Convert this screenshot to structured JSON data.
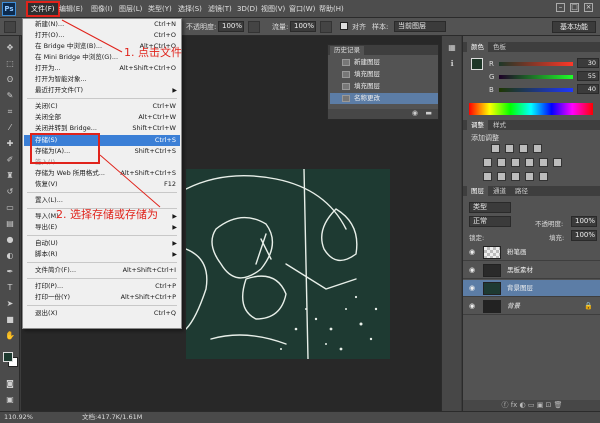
{
  "menubar": {
    "logo": "Ps",
    "items": [
      "文件(F)",
      "编辑(E)",
      "图像(I)",
      "图层(L)",
      "类型(Y)",
      "选择(S)",
      "滤镜(T)",
      "3D(D)",
      "视图(V)",
      "窗口(W)",
      "帮助(H)"
    ]
  },
  "options": {
    "opacity_label": "不透明度:",
    "opacity_value": "100%",
    "flow_label": "流量:",
    "flow_value": "100%",
    "align_label": "对齐",
    "sample_label": "样本:",
    "sample_value": "当前图层",
    "workspace_btn": "基本功能"
  },
  "file_menu": {
    "items": [
      {
        "label": "新建(N)...",
        "shortcut": "Ctrl+N"
      },
      {
        "label": "打开(O)...",
        "shortcut": "Ctrl+O"
      },
      {
        "label": "在 Bridge 中浏览(B)...",
        "shortcut": "Alt+Ctrl+O"
      },
      {
        "label": "在 Mini Bridge 中浏览(G)...",
        "shortcut": ""
      },
      {
        "label": "打开为...",
        "shortcut": "Alt+Shift+Ctrl+O"
      },
      {
        "label": "打开为智能对象...",
        "shortcut": ""
      },
      {
        "label": "最近打开文件(T)",
        "shortcut": ""
      },
      {
        "label": "关闭(C)",
        "shortcut": "Ctrl+W"
      },
      {
        "label": "关闭全部",
        "shortcut": "Alt+Ctrl+W"
      },
      {
        "label": "关闭并转到 Bridge...",
        "shortcut": "Shift+Ctrl+W"
      },
      {
        "label": "存储(S)",
        "shortcut": "Ctrl+S"
      },
      {
        "label": "存储为(A)...",
        "shortcut": "Shift+Ctrl+S"
      },
      {
        "label": "签入(I)...",
        "shortcut": ""
      },
      {
        "label": "存储为 Web 所用格式...",
        "shortcut": "Alt+Shift+Ctrl+S"
      },
      {
        "label": "恢复(V)",
        "shortcut": "F12"
      },
      {
        "label": "置入(L)...",
        "shortcut": ""
      },
      {
        "label": "导入(M)",
        "shortcut": ""
      },
      {
        "label": "导出(E)",
        "shortcut": ""
      },
      {
        "label": "自动(U)",
        "shortcut": ""
      },
      {
        "label": "脚本(R)",
        "shortcut": ""
      },
      {
        "label": "文件简介(F)...",
        "shortcut": "Alt+Shift+Ctrl+I"
      },
      {
        "label": "打印(P)...",
        "shortcut": "Ctrl+P"
      },
      {
        "label": "打印一份(Y)",
        "shortcut": "Alt+Shift+Ctrl+P"
      },
      {
        "label": "退出(X)",
        "shortcut": "Ctrl+Q"
      }
    ]
  },
  "annotations": {
    "step1": "1. 点击文件",
    "step2": "2. 选择存储或存储为"
  },
  "history": {
    "tab": "历史记录",
    "rows": [
      "新建图层",
      "填充图层",
      "填充图层",
      "名称更改"
    ]
  },
  "color_panel": {
    "tabs": [
      "颜色",
      "色板"
    ],
    "r_label": "R",
    "r_value": "30",
    "g_label": "G",
    "g_value": "55",
    "b_label": "B",
    "b_value": "40"
  },
  "adjustments": {
    "tabs": [
      "调整",
      "样式"
    ],
    "title": "添加调整"
  },
  "layers": {
    "tabs": [
      "图层",
      "通道",
      "路径"
    ],
    "kind_value": "类型",
    "blend_value": "正常",
    "opacity_label": "不透明度:",
    "opacity_value": "100%",
    "lock_label": "锁定:",
    "fill_label": "填充:",
    "fill_value": "100%",
    "rows": [
      {
        "name": "粉笔画"
      },
      {
        "name": "黑板素材"
      },
      {
        "name": "背景图层"
      },
      {
        "name": "背景"
      }
    ],
    "footer_icons": "ⓕ fx ◐ ▭ ▣ ⊡ 🗑"
  },
  "status": {
    "zoom": "110.92%",
    "doc": "文档:417.7K/1.61M"
  },
  "colors": {
    "accent_red": "#e0231b",
    "highlight_blue": "#3b7fd6",
    "canvas_green": "#1e3a32"
  }
}
